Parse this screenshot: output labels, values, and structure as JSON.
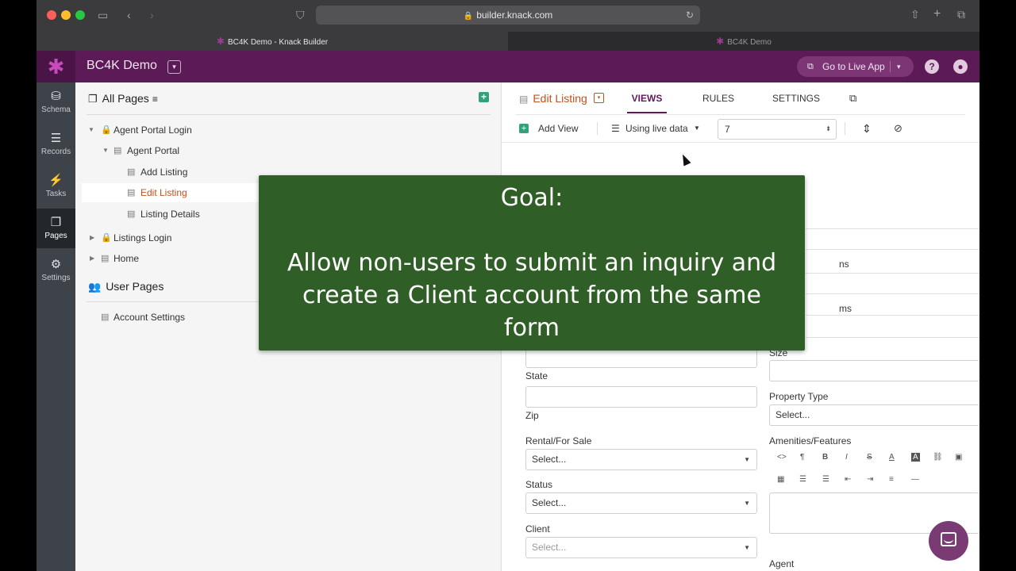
{
  "browser": {
    "url": "builder.knack.com",
    "tabs": [
      {
        "label": "BC4K Demo - Knack Builder"
      },
      {
        "label": "BC4K Demo"
      }
    ]
  },
  "header": {
    "app_title": "BC4K Demo",
    "live_app_label": "Go to Live App",
    "help_icon": "?",
    "brand_color": "#5c1a57"
  },
  "rail": [
    {
      "label": "Schema",
      "icon": "schema-icon"
    },
    {
      "label": "Records",
      "icon": "database-icon"
    },
    {
      "label": "Tasks",
      "icon": "bolt-icon"
    },
    {
      "label": "Pages",
      "icon": "pages-icon"
    },
    {
      "label": "Settings",
      "icon": "gear-icon"
    }
  ],
  "pages_panel": {
    "header": "All Pages",
    "tree": [
      {
        "label": "Agent Portal Login"
      },
      {
        "label": "Agent Portal"
      },
      {
        "label": "Add Listing"
      },
      {
        "label": "Edit Listing"
      },
      {
        "label": "Listing Details"
      },
      {
        "label": "Listings Login"
      },
      {
        "label": "Home"
      }
    ],
    "user_pages_header": "User Pages",
    "user_pages": [
      {
        "label": "Account Settings"
      }
    ]
  },
  "main": {
    "page_title": "Edit Listing",
    "tabs": {
      "views": "VIEWS",
      "rules": "RULES",
      "settings": "SETTINGS"
    },
    "toolbar": {
      "add_view": "Add View",
      "live_data": "Using live data",
      "record_value": "7"
    },
    "form": {
      "state_label": "State",
      "zip_label": "Zip",
      "rental_label": "Rental/For Sale",
      "rental_value": "Select...",
      "status_label": "Status",
      "status_value": "Select...",
      "client_label": "Client",
      "client_value": "Select...",
      "size_label": "Size",
      "property_type_label": "Property Type",
      "property_type_value": "Select...",
      "amenities_label": "Amenities/Features",
      "agent_label": "Agent",
      "partial_ns": "ns",
      "partial_ms": "ms"
    }
  },
  "overlay": {
    "goal_heading": "Goal:",
    "goal_text": "Allow non-users to submit an inquiry and create a Client account from the same form"
  }
}
